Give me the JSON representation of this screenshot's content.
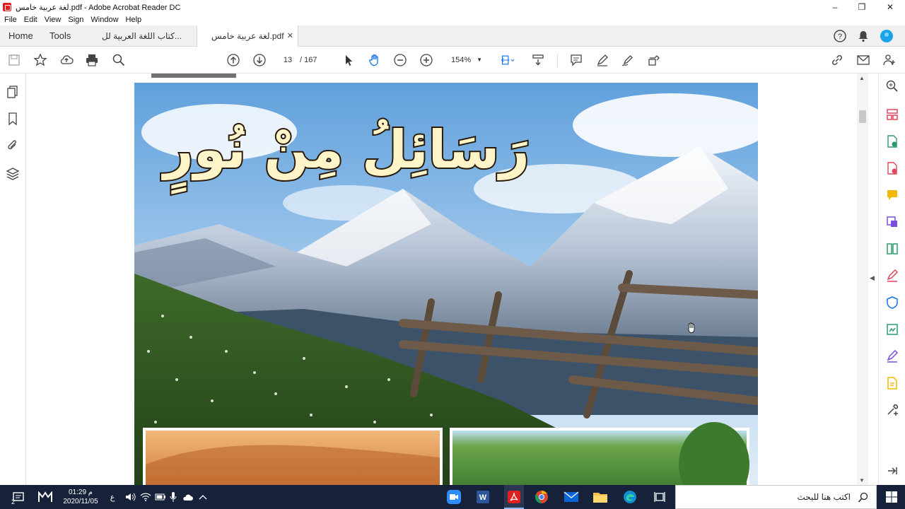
{
  "window": {
    "title": "لغة عربية خامس.pdf - Adobe Acrobat Reader DC",
    "minimize_label": "–",
    "restore_label": "❐",
    "close_label": "✕"
  },
  "menu": [
    "File",
    "Edit",
    "View",
    "Sign",
    "Window",
    "Help"
  ],
  "tabs": {
    "home": "Home",
    "tools": "Tools",
    "docs": [
      {
        "label": "كتاب اللغة العربية لل..."
      },
      {
        "label": "لغة عربية خامس.pdf",
        "close": "✕"
      }
    ]
  },
  "toolbar": {
    "current_page": "13",
    "total_pages": "/   167",
    "zoom": "154%"
  },
  "document": {
    "page_heading": "رَسَائِلُ مِنْ نُورٍ"
  },
  "taskbar": {
    "search_placeholder": "اكتب هنا للبحث",
    "time": "01:29 م",
    "date": "2020/11/05",
    "language": "ع",
    "notification_count": "2"
  },
  "colors": {
    "accent_blue": "#1473e6",
    "acrobat_red": "#e02020",
    "taskbar": "#16223a"
  }
}
